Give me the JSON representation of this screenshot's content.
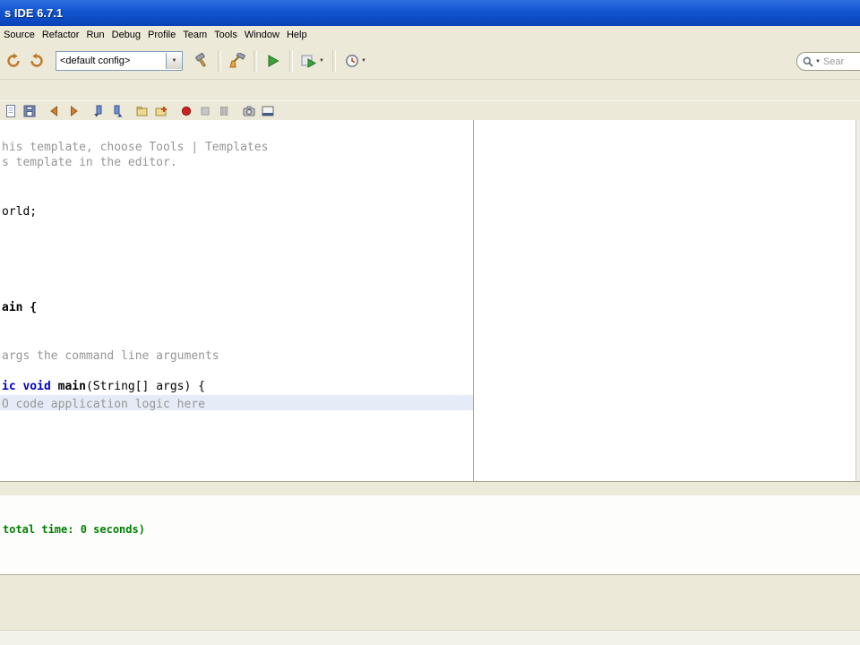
{
  "window": {
    "title": "s IDE 6.7.1"
  },
  "menubar": {
    "items": [
      "Source",
      "Refactor",
      "Run",
      "Debug",
      "Profile",
      "Team",
      "Tools",
      "Window",
      "Help"
    ]
  },
  "toolbar": {
    "config_combo": {
      "value": "<default config>"
    },
    "icons": [
      "undo-icon",
      "redo-icon",
      "build-project-icon",
      "clean-and-build-project-icon",
      "run-project-icon",
      "debug-project-icon",
      "profile-project-icon",
      "search-icon"
    ],
    "search": {
      "placeholder": "Sear"
    }
  },
  "toolbar2": {
    "icons": [
      "new-file-icon",
      "save-all-icon",
      "back-icon",
      "forward-icon",
      "previous-bookmark-icon",
      "next-bookmark-icon",
      "open-folder-icon",
      "add-folder-icon",
      "record-icon",
      "stop-icon",
      "pause-icon",
      "snapshot-icon",
      "dock-window-icon"
    ]
  },
  "editor": {
    "code": {
      "line1": "his template, choose Tools | Templates",
      "line2": "s template in the editor.",
      "line3": "orld;",
      "line4": "ain {",
      "line5": "args the command line arguments",
      "line6_keyword": "ic void ",
      "line6_method": "main",
      "line6_rest": "(String[] args) {",
      "line7": "O code application logic here"
    }
  },
  "output": {
    "message": "total time: 0 seconds)"
  },
  "colors": {
    "titlebar_blue": "#1254cf",
    "window_chrome": "#ece9d8",
    "keyword_blue": "#0000c8",
    "comment_gray": "#969696",
    "current_line_highlight": "#e6ecf7",
    "margin_line_red": "#dd8b7e",
    "output_green": "#008000"
  }
}
